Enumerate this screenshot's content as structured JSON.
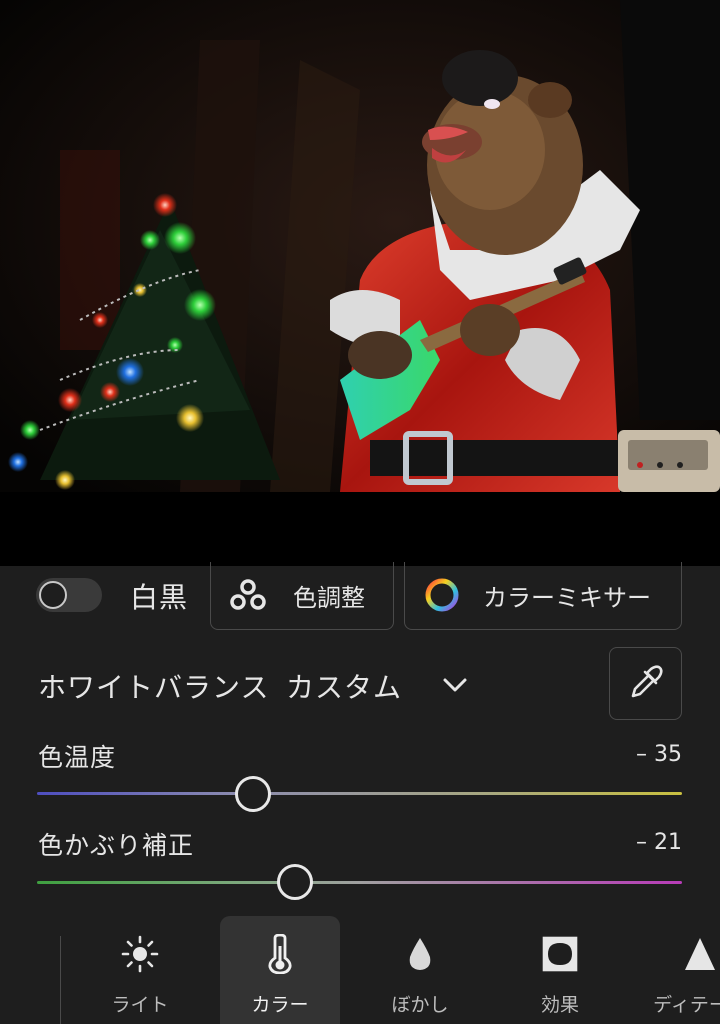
{
  "photo": {
    "subject": "costumed bear animatronic in red Santa suit playing a green guitar beside a lit Christmas tree"
  },
  "color_panel": {
    "bw_toggle": {
      "label": "白黒",
      "on": false
    },
    "grading_button": {
      "label": "色調整",
      "icon": "three-circles-icon"
    },
    "mixer_button": {
      "label": "カラーミキサー",
      "icon": "color-wheel-icon"
    },
    "white_balance": {
      "label": "ホワイトバランス",
      "value": "カスタム",
      "dropdown_icon": "chevron-down-icon",
      "eyedropper_icon": "eyedropper-icon"
    },
    "temperature": {
      "label": "色温度",
      "value": "– 35",
      "colors": [
        "#4e4ec0",
        "#c9c040"
      ]
    },
    "tint": {
      "label": "色かぶり補正",
      "value": "– 21",
      "colors": [
        "#3fa040",
        "#b83cb8"
      ]
    }
  },
  "toolbar": {
    "tools": [
      {
        "label": "ライト",
        "icon": "sun-icon",
        "active": false
      },
      {
        "label": "カラー",
        "icon": "thermometer-icon",
        "active": true
      },
      {
        "label": "ぼかし",
        "icon": "drop-icon",
        "active": false
      },
      {
        "label": "効果",
        "icon": "vignette-icon",
        "active": false
      },
      {
        "label": "ディテール",
        "icon": "triangle-icon",
        "active": false
      }
    ]
  }
}
